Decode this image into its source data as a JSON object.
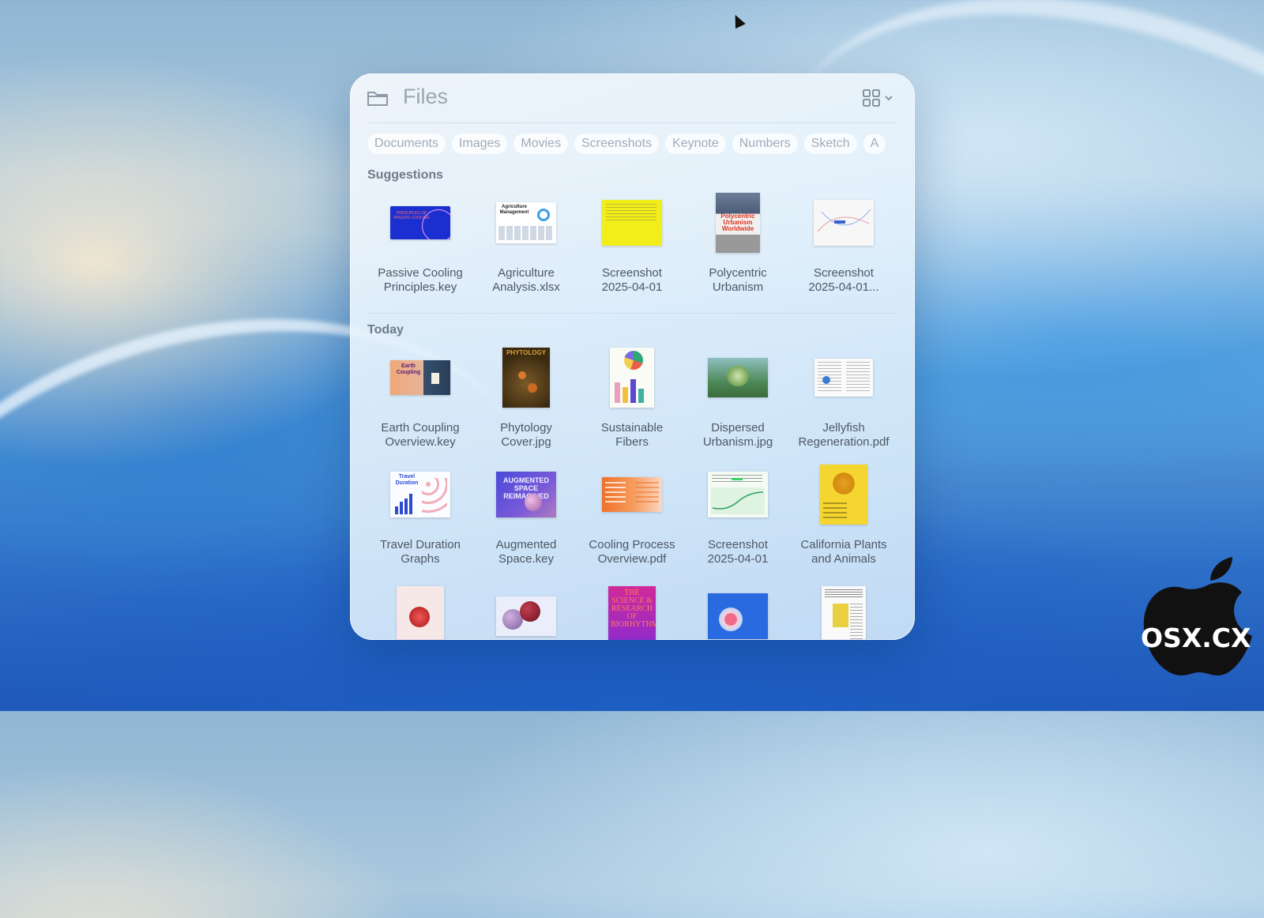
{
  "window": {
    "title": "Files"
  },
  "filters": [
    "Documents",
    "Images",
    "Movies",
    "Screenshots",
    "Keynote",
    "Numbers",
    "Sketch",
    "A"
  ],
  "sections": {
    "suggestions": {
      "title": "Suggestions",
      "items": [
        {
          "line1": "Passive Cooling",
          "line2": "Principles.key"
        },
        {
          "line1": "Agriculture",
          "line2": "Analysis.xlsx"
        },
        {
          "line1": "Screenshot",
          "line2": "2025-04-01"
        },
        {
          "line1": "Polycentric",
          "line2": "Urbanism"
        },
        {
          "line1": "Screenshot",
          "line2": "2025-04-01..."
        }
      ]
    },
    "today": {
      "title": "Today",
      "items": [
        {
          "line1": "Earth Coupling",
          "line2": "Overview.key"
        },
        {
          "line1": "Phytology",
          "line2": "Cover.jpg"
        },
        {
          "line1": "Sustainable",
          "line2": "Fibers"
        },
        {
          "line1": "Dispersed",
          "line2": "Urbanism.jpg"
        },
        {
          "line1": "Jellyfish",
          "line2": "Regeneration.pdf"
        },
        {
          "line1": "Travel Duration",
          "line2": "Graphs"
        },
        {
          "line1": "Augmented",
          "line2": "Space.key"
        },
        {
          "line1": "Cooling Process",
          "line2": "Overview.pdf"
        },
        {
          "line1": "Screenshot",
          "line2": "2025-04-01"
        },
        {
          "line1": "California Plants",
          "line2": "and Animals"
        }
      ]
    }
  },
  "thumb_text": {
    "passive": "PRINCIPLES OF PASSIVE COOLING",
    "agri": "Agriculture Management",
    "poly": "Polycentric Urbanism Worldwide",
    "earth": "Earth Coupling",
    "phyto": "PHYTOLOGY",
    "travel": "Travel Duration",
    "aug": "AUGMENTED SPACE REIMAGINED",
    "science": "THE SCIENCE & RESEARCH OF BIORHYTHMS"
  },
  "watermark": {
    "text": "OSX.CX"
  }
}
